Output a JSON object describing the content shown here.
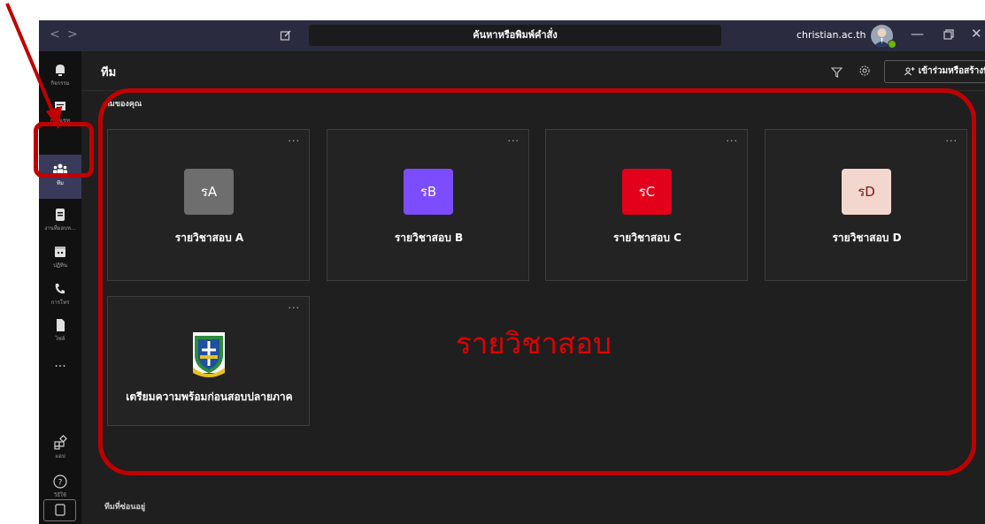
{
  "titlebar": {
    "search_placeholder": "ค้นหาหรือพิมพ์คำสั่ง",
    "account": "christian.ac.th",
    "account_chevron": "⌄"
  },
  "rail": {
    "items": [
      {
        "label": "กิจกรรม",
        "icon": "bell-icon"
      },
      {
        "label": "การแชท",
        "icon": "chat-icon"
      },
      {
        "label": "ทีม",
        "icon": "teams-icon"
      },
      {
        "label": "งานที่มอบห...",
        "icon": "assignments-icon"
      },
      {
        "label": "ปฏิทิน",
        "icon": "calendar-icon"
      },
      {
        "label": "การโทร",
        "icon": "phone-icon"
      },
      {
        "label": "ไฟล์",
        "icon": "file-icon"
      },
      {
        "label": "...",
        "icon": "more-icon"
      },
      {
        "label": "แอป",
        "icon": "apps-icon"
      },
      {
        "label": "วิธีใช้",
        "icon": "help-icon"
      }
    ],
    "active_index": 2
  },
  "header": {
    "title": "ทีม",
    "join_create_label": "เข้าร่วมหรือสร้างทีม"
  },
  "sections": {
    "your_teams": "ทีมของคุณ",
    "hidden_teams": "ทีมที่ซ่อนอยู่"
  },
  "teams": [
    {
      "initials": "รA",
      "name": "รายวิชาสอบ A",
      "color": "#6e6e6e"
    },
    {
      "initials": "รB",
      "name": "รายวิชาสอบ B",
      "color": "#7c4dff"
    },
    {
      "initials": "รC",
      "name": "รายวิชาสอบ C",
      "color": "#e3001b"
    },
    {
      "initials": "รD",
      "name": "รายวิชาสอบ D",
      "color": "#f3d6cd"
    }
  ],
  "school_team": {
    "name": "เตรียมความพร้อมก่อนสอบปลายภาค"
  },
  "card_more": "···",
  "annotation": {
    "text": "รายวิชาสอบ",
    "color": "#c00000"
  }
}
